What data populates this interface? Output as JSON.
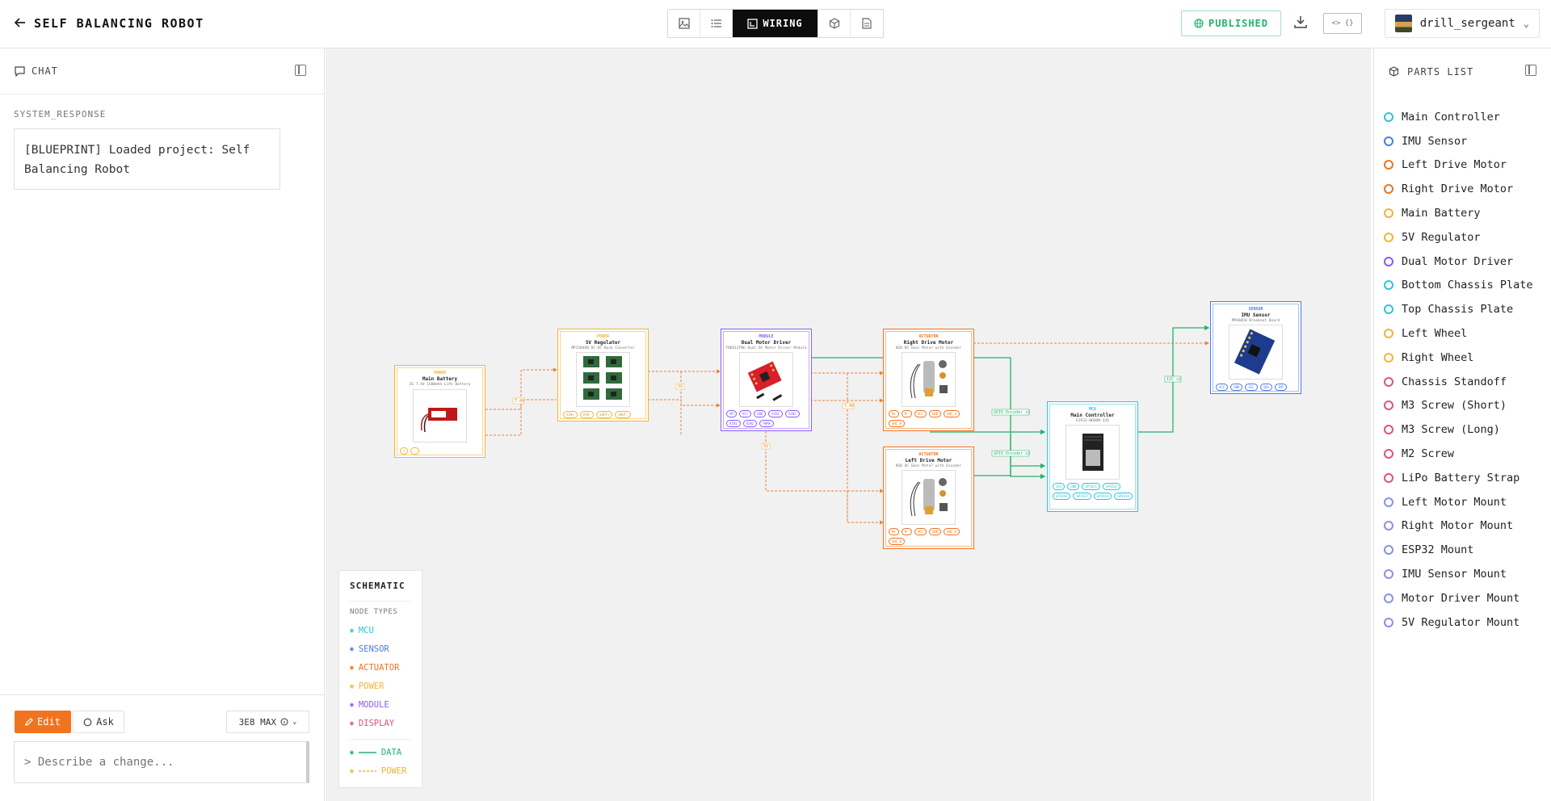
{
  "header": {
    "title": "SELF BALANCING ROBOT",
    "views": [
      {
        "name": "image-view",
        "label": ""
      },
      {
        "name": "list-view",
        "label": ""
      },
      {
        "name": "wiring-view",
        "label": "WIRING"
      },
      {
        "name": "3d-view",
        "label": ""
      },
      {
        "name": "doc-view",
        "label": ""
      }
    ],
    "published_label": "PUBLISHED",
    "embed_label": "<> {}",
    "username": "drill_sergeant"
  },
  "chat": {
    "title": "CHAT",
    "system_label": "SYSTEM_RESPONSE",
    "message": "[BLUEPRINT] Loaded project: Self Balancing Robot",
    "edit_label": "Edit",
    "ask_label": "Ask",
    "model_label": "3E8 MAX",
    "input_placeholder": "> Describe a change..."
  },
  "parts": {
    "title": "PARTS LIST",
    "items": [
      {
        "label": "Main Controller",
        "color": "#2cc4dc"
      },
      {
        "label": "IMU Sensor",
        "color": "#4a7de0"
      },
      {
        "label": "Left Drive Motor",
        "color": "#f0741f"
      },
      {
        "label": "Right Drive Motor",
        "color": "#f0741f"
      },
      {
        "label": "Main Battery",
        "color": "#f5b335"
      },
      {
        "label": "5V Regulator",
        "color": "#f5b335"
      },
      {
        "label": "Dual Motor Driver",
        "color": "#8b5cf6"
      },
      {
        "label": "Bottom Chassis Plate",
        "color": "#2cc4dc"
      },
      {
        "label": "Top Chassis Plate",
        "color": "#2cc4dc"
      },
      {
        "label": "Left Wheel",
        "color": "#f5b335"
      },
      {
        "label": "Right Wheel",
        "color": "#f5b335"
      },
      {
        "label": "Chassis Standoff",
        "color": "#e0527a"
      },
      {
        "label": "M3 Screw (Short)",
        "color": "#e0527a"
      },
      {
        "label": "M3 Screw (Long)",
        "color": "#e0527a"
      },
      {
        "label": "M2 Screw",
        "color": "#e0527a"
      },
      {
        "label": "LiPo Battery Strap",
        "color": "#e0527a"
      },
      {
        "label": "Left Motor Mount",
        "color": "#8b8fe6"
      },
      {
        "label": "Right Motor Mount",
        "color": "#8b8fe6"
      },
      {
        "label": "ESP32 Mount",
        "color": "#8b8fe6"
      },
      {
        "label": "IMU Sensor Mount",
        "color": "#8b8fe6"
      },
      {
        "label": "Motor Driver Mount",
        "color": "#8b8fe6"
      },
      {
        "label": "5V Regulator Mount",
        "color": "#8b8fe6"
      }
    ]
  },
  "legend": {
    "title": "SCHEMATIC",
    "subtitle": "NODE TYPES",
    "types": [
      {
        "label": "MCU",
        "color": "#2cc4dc"
      },
      {
        "label": "SENSOR",
        "color": "#4a7de0"
      },
      {
        "label": "ACTUATOR",
        "color": "#f0741f"
      },
      {
        "label": "POWER",
        "color": "#f5b335"
      },
      {
        "label": "MODULE",
        "color": "#8b5cf6"
      },
      {
        "label": "DISPLAY",
        "color": "#e0527a"
      }
    ],
    "data_label": "DATA",
    "power_label": "POWER",
    "data_color": "#22b36b",
    "power_color": "#f5b335"
  },
  "nodes": {
    "battery": {
      "type": "POWER",
      "title": "Main Battery",
      "sub": "2S 7.4V 1500mAh LiPo Battery",
      "pins": [
        "+",
        "-"
      ]
    },
    "regulator": {
      "type": "POWER",
      "title": "5V Regulator",
      "sub": "MP1584EN DC-DC Buck Converter",
      "pins": [
        "VIN+",
        "VIN-",
        "VOUT+",
        "VOUT-"
      ]
    },
    "driver": {
      "type": "MODULE",
      "title": "Dual Motor Driver",
      "sub": "TB6612FNG Dual DC Motor Driver Module",
      "pins": [
        "VM",
        "VCC",
        "GND",
        "AIN1",
        "AIN2",
        "BIN1",
        "BIN2",
        "PWMA"
      ]
    },
    "right_motor": {
      "type": "ACTUATOR",
      "title": "Right Drive Motor",
      "sub": "N20 DC Gear Motor with Encoder",
      "pins": [
        "M+",
        "M-",
        "VCC",
        "GND",
        "ENC_A",
        "ENC_B"
      ]
    },
    "left_motor": {
      "type": "ACTUATOR",
      "title": "Left Drive Motor",
      "sub": "N20 DC Gear Motor with Encoder",
      "pins": [
        "M+",
        "M-",
        "VCC",
        "GND",
        "ENC_A",
        "ENC_B"
      ]
    },
    "controller": {
      "type": "MCU",
      "title": "Main Controller",
      "sub": "ESP32-WROOM-32D",
      "pins": [
        "3V3",
        "GND",
        "GPIO21",
        "GPIO22",
        "GPIO16",
        "GPIO17",
        "GPIO18",
        "GPIO19"
      ]
    },
    "imu": {
      "type": "SENSOR",
      "title": "IMU Sensor",
      "sub": "MPU6050 Breakout Board",
      "pins": [
        "VCC",
        "GND",
        "SCL",
        "SDA",
        "INT"
      ]
    }
  },
  "wire_labels": {
    "batt_reg": "7.4V",
    "reg_drv": "5V",
    "drv_down": "5V",
    "drv_motor": "7.4V",
    "gpio_right": "GPIO Encoder x2",
    "gpio_left": "GPIO Encoder x2",
    "i2c": "I2C x2"
  }
}
